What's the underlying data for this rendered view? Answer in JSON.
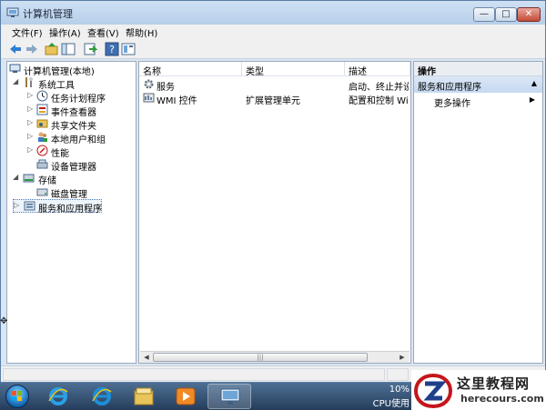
{
  "window": {
    "title": "计算机管理",
    "controls": {
      "minimize": "—",
      "maximize": "□",
      "close": "✕"
    }
  },
  "menu": [
    "文件(F)",
    "操作(A)",
    "查看(V)",
    "帮助(H)"
  ],
  "toolbar": [
    "back-arrow-icon",
    "forward-arrow-icon",
    "up-folder-icon",
    "show-hide-tree-icon",
    "export-list-icon",
    "help-icon",
    "properties-icon"
  ],
  "tree": {
    "root": "计算机管理(本地)",
    "system_tools": "系统工具",
    "task_scheduler": "任务计划程序",
    "event_viewer": "事件查看器",
    "shared_folders": "共享文件夹",
    "local_users": "本地用户和组",
    "performance": "性能",
    "device_manager": "设备管理器",
    "storage": "存储",
    "disk_management": "磁盘管理",
    "services_apps": "服务和应用程序"
  },
  "list": {
    "headers": {
      "name": "名称",
      "type": "类型",
      "desc": "描述"
    },
    "rows": [
      {
        "name": "服务",
        "type": "",
        "desc": "启动、终止并设"
      },
      {
        "name": "WMI 控件",
        "type": "扩展管理单元",
        "desc": "配置和控制 Wind"
      }
    ]
  },
  "actions": {
    "header": "操作",
    "section": "服务和应用程序",
    "more": "更多操作"
  },
  "taskbar": {
    "cpu_value": "10%",
    "cpu_label": "CPU使用"
  },
  "brand": {
    "title": "这里教程网",
    "url": "herecours.com"
  },
  "colors": {
    "title_bar": "#b7cfe9",
    "selection": "#eef4fb",
    "action_section": "#c5d9f1",
    "taskbar": "#253d5c",
    "brand_red": "#c4161c"
  }
}
